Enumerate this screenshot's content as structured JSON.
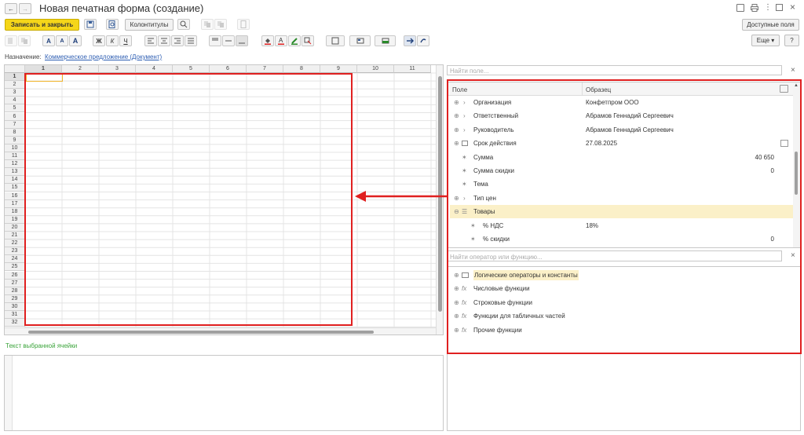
{
  "window": {
    "title": "Новая печатная форма (создание)",
    "back_icon": "←",
    "forward_icon": "→",
    "top_icons": [
      "link-icon",
      "print-icon",
      "more-icon",
      "restore-icon",
      "close-icon"
    ]
  },
  "toolbar": {
    "save_close": "Записать и закрыть",
    "headers_footers": "Колонтитулы",
    "available_fields": "Доступные поля",
    "more": "Еще",
    "more_caret": "▾",
    "help": "?",
    "bold": "Ж",
    "italic": "К",
    "underline": "Ч",
    "font_a": "A",
    "font_a_up": "A",
    "font_a_down": "A"
  },
  "purpose": {
    "label": "Назначение:",
    "link": "Коммерческое предложение (Документ)"
  },
  "grid": {
    "columns": [
      "1",
      "2",
      "3",
      "4",
      "5",
      "6",
      "7",
      "8",
      "9",
      "10",
      "11"
    ],
    "rows": [
      "1",
      "2",
      "3",
      "4",
      "5",
      "6",
      "7",
      "8",
      "9",
      "10",
      "11",
      "12",
      "13",
      "14",
      "15",
      "16",
      "17",
      "18",
      "19",
      "20",
      "21",
      "22",
      "23",
      "24",
      "25",
      "26",
      "27",
      "28",
      "29",
      "30",
      "31",
      "32"
    ]
  },
  "cell_text": {
    "label": "Текст выбранной ячейки"
  },
  "fields_panel": {
    "search_placeholder": "Найти поле...",
    "clear": "×",
    "col_field": "Поле",
    "col_sample": "Образец",
    "rows": [
      {
        "name": "Организация",
        "sample": "Конфетпром ООО",
        "num": "",
        "icon": "expand"
      },
      {
        "name": "Ответственный",
        "sample": "Абрамов Геннадий Сергеевич",
        "num": "",
        "icon": "expand"
      },
      {
        "name": "Руководитель",
        "sample": "Абрамов Геннадий Сергеевич",
        "num": "",
        "icon": "expand"
      },
      {
        "name": "Срок действия",
        "sample": "27.08.2025",
        "num": "",
        "icon": "calendar"
      },
      {
        "name": "Сумма",
        "sample": "",
        "num": "40 650",
        "icon": "star"
      },
      {
        "name": "Сумма скидки",
        "sample": "",
        "num": "0",
        "icon": "star"
      },
      {
        "name": "Тема",
        "sample": "",
        "num": "",
        "icon": "star"
      },
      {
        "name": "Тип цен",
        "sample": "",
        "num": "",
        "icon": "expand"
      },
      {
        "name": "Товары",
        "sample": "",
        "num": "",
        "icon": "list"
      },
      {
        "name": "% НДС",
        "sample": "18%",
        "num": "",
        "icon": "star-sub"
      },
      {
        "name": "% скидки",
        "sample": "",
        "num": "0",
        "icon": "star-sub"
      }
    ]
  },
  "functions_panel": {
    "search_placeholder": "Найти оператор или функцию...",
    "clear": "×",
    "items": [
      {
        "name": "Логические операторы и константы",
        "icon": "folder"
      },
      {
        "name": "Числовые функции",
        "icon": "fx"
      },
      {
        "name": "Строковые функции",
        "icon": "fx"
      },
      {
        "name": "Функции для табличных частей",
        "icon": "fx"
      },
      {
        "name": "Прочие функции",
        "icon": "fx"
      }
    ]
  },
  "colors": {
    "accent_yellow": "#f5d619",
    "highlight_row": "#fbf0c8",
    "red_annotation": "#e02020",
    "link_blue": "#2f5fb3",
    "green_label": "#3aa43a"
  }
}
